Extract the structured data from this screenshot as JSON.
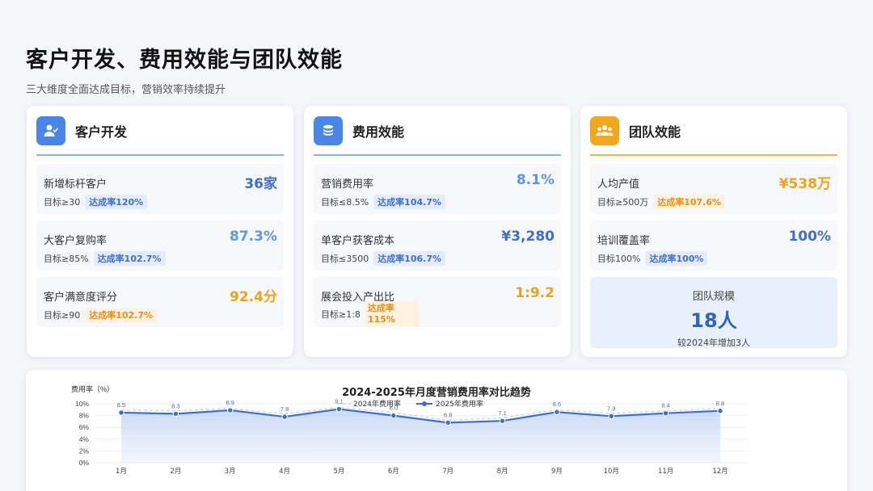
{
  "page": {
    "title": "客户开发、费用效能与团队效能",
    "subtitle": "三大维度全面达成目标，营销效率持续提升"
  },
  "colors": {
    "blue": "#3e6fd0",
    "light_blue": "#6fa1ea",
    "orange": "#f0a21a",
    "card_bg": "#ffffff"
  },
  "cards": [
    {
      "title": "客户开发",
      "icon": "user-check-icon",
      "metrics": [
        {
          "label": "新增标杆客户",
          "value": "36家",
          "target": "目标≥30",
          "rate": "达成率120%",
          "value_color": "#3e6fd0",
          "badge": "blue"
        },
        {
          "label": "大客户复购率",
          "value": "87.3%",
          "target": "目标≥85%",
          "rate": "达成率102.7%",
          "value_color": "#5f96e6",
          "badge": "blue"
        },
        {
          "label": "客户满意度评分",
          "value": "92.4分",
          "target": "目标≥90",
          "rate": "达成率102.7%",
          "value_color": "#f0a21a",
          "badge": "orange"
        }
      ]
    },
    {
      "title": "费用效能",
      "icon": "coins-icon",
      "metrics": [
        {
          "label": "营销费用率",
          "value": "8.1%",
          "target": "目标≤8.5%",
          "rate": "达成率104.7%",
          "value_color": "#5f96e6",
          "badge": "blue"
        },
        {
          "label": "单客户获客成本",
          "value": "¥3,280",
          "target": "目标≤3500",
          "rate": "达成率106.7%",
          "value_color": "#3e6fd0",
          "badge": "blue"
        },
        {
          "label": "展会投入产出比",
          "value": "1:9.2",
          "target": "目标≥1:8",
          "rate": "达成率115%",
          "value_color": "#f0a21a",
          "badge": "orange"
        }
      ]
    },
    {
      "title": "团队效能",
      "icon": "team-icon",
      "metrics": [
        {
          "label": "人均产值",
          "value": "¥538万",
          "target": "目标≥500万",
          "rate": "达成率107.6%",
          "value_color": "#f0a21a",
          "badge": "orange"
        },
        {
          "label": "培训覆盖率",
          "value": "100%",
          "target": "目标100%",
          "rate": "达成率100%",
          "value_color": "#3e6fd0",
          "badge": "blue"
        }
      ],
      "team": {
        "label": "团队规模",
        "value": "18人",
        "note": "较2024年增加3人"
      }
    }
  ],
  "chart_data": {
    "type": "line",
    "title": "2024-2025年月度营销费用率对比趋势",
    "ylabel": "费用率（%）",
    "ylim": [
      0,
      10
    ],
    "yticks": [
      "0%",
      "2%",
      "4%",
      "6%",
      "8%",
      "10%"
    ],
    "categories": [
      "1月",
      "2月",
      "3月",
      "4月",
      "5月",
      "6月",
      "7月",
      "8月",
      "9月",
      "10月",
      "11月",
      "12月"
    ],
    "series": [
      {
        "name": "2024年费用率",
        "values": [
          9.0,
          8.8,
          9.2,
          8.3,
          9.4,
          8.5,
          7.2,
          7.6,
          9.0,
          8.4,
          8.8,
          9.2
        ],
        "color": "#c7d6f3",
        "style": "dashed"
      },
      {
        "name": "2025年费用率",
        "values": [
          8.5,
          8.3,
          8.9,
          7.8,
          9.1,
          8.0,
          6.8,
          7.1,
          8.6,
          7.9,
          8.4,
          8.8
        ],
        "color": "#3e6fd0",
        "style": "solid",
        "labels": [
          "8.5",
          "8.3",
          "8.9",
          "7.8",
          "9.1",
          "8.0",
          "6.8",
          "7.1",
          "8.6",
          "7.9",
          "8.4",
          "8.8"
        ]
      }
    ],
    "grid": true,
    "legend": "top-center"
  }
}
